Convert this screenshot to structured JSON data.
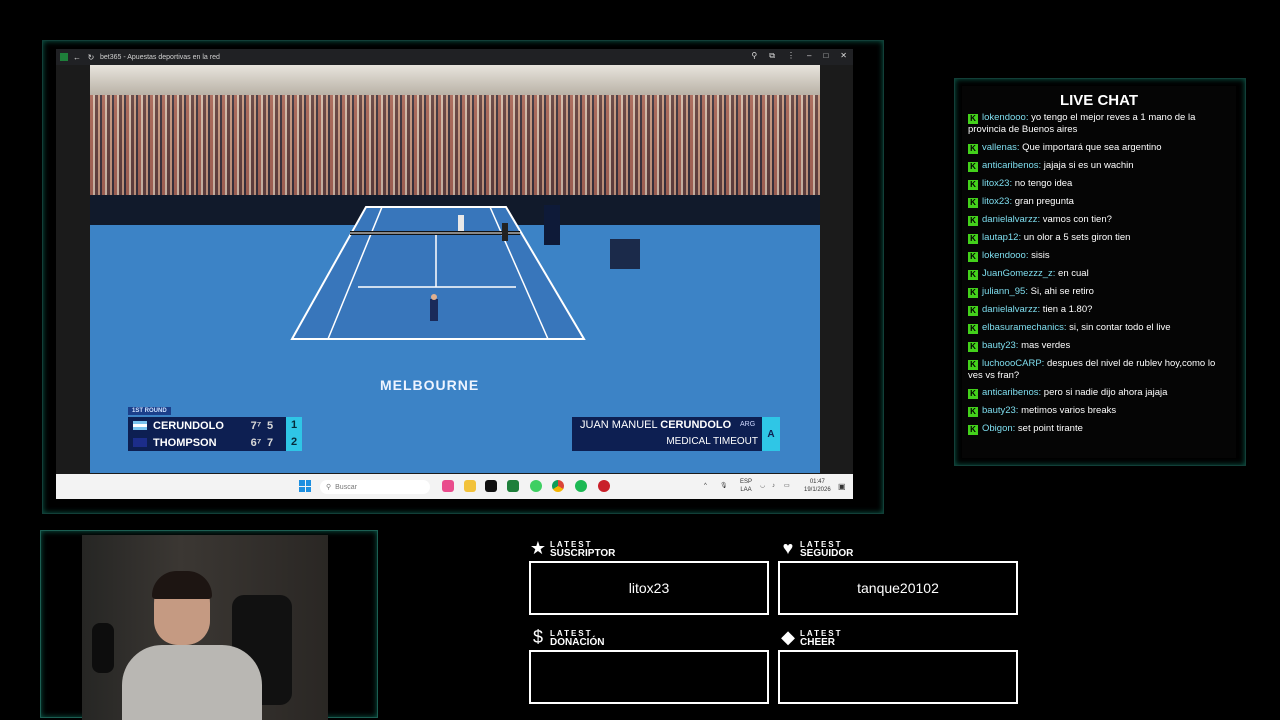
{
  "browser": {
    "tab_title": "bet365 - Apuestas deportivas en la red"
  },
  "broadcast": {
    "round_label": "1ST ROUND",
    "players": [
      {
        "name": "CERUNDOLO",
        "set1": "7⁷",
        "set2": "5",
        "current": "1"
      },
      {
        "name": "THOMPSON",
        "set1": "6⁷",
        "set2": "7",
        "current": "2"
      }
    ],
    "ticker_first": "JUAN MANUEL ",
    "ticker_last": "CERUNDOLO",
    "ticker_country": "ARG",
    "ticker_sub": "MEDICAL TIMEOUT",
    "court_text": "MELBOURNE"
  },
  "taskbar": {
    "search_placeholder": "Buscar",
    "lang_line1": "ESP",
    "lang_line2": "LAA",
    "time": "01:47",
    "date": "19/1/2026"
  },
  "chat": {
    "title": "LIVE CHAT",
    "messages": [
      {
        "user": "lokendooo:",
        "text": " yo tengo el mejor reves a 1 mano de la provincia de Buenos aires"
      },
      {
        "user": "vallenas:",
        "text": " Que importará que sea argentino"
      },
      {
        "user": "anticaribenos:",
        "text": " jajaja si es un wachin"
      },
      {
        "user": "litox23:",
        "text": " no tengo idea"
      },
      {
        "user": "litox23:",
        "text": " gran pregunta"
      },
      {
        "user": "danielalvarzz:",
        "text": " vamos con tien?"
      },
      {
        "user": "lautap12:",
        "text": " un olor a 5 sets giron tien"
      },
      {
        "user": "lokendooo:",
        "text": " sisis"
      },
      {
        "user": "JuanGomezzz_z:",
        "text": " en cual"
      },
      {
        "user": "juliann_95:",
        "text": " Si, ahi se retiro"
      },
      {
        "user": "danielalvarzz:",
        "text": " tien a 1.80?"
      },
      {
        "user": "elbasuramechanics:",
        "text": " si, sin contar todo el live"
      },
      {
        "user": "bauty23:",
        "text": " mas verdes"
      },
      {
        "user": "luchoooCARP:",
        "text": " despues del nivel de rublev hoy,como lo ves vs fran?"
      },
      {
        "user": "anticaribenos:",
        "text": " pero si nadie dijo ahora jajaja"
      },
      {
        "user": "bauty23:",
        "text": " metimos varios breaks"
      },
      {
        "user": "Obigon:",
        "text": " set point tirante"
      }
    ]
  },
  "latest": {
    "suscriptor": {
      "small": "LATEST",
      "big": "SUSCRIPTOR",
      "value": "litox23"
    },
    "seguidor": {
      "small": "LATEST",
      "big": "SEGUIDOR",
      "value": "tanque20102"
    },
    "donacion": {
      "small": "LATEST",
      "big": "DONACIÓN",
      "value": ""
    },
    "cheer": {
      "small": "LATEST",
      "big": "CHEER",
      "value": ""
    }
  }
}
